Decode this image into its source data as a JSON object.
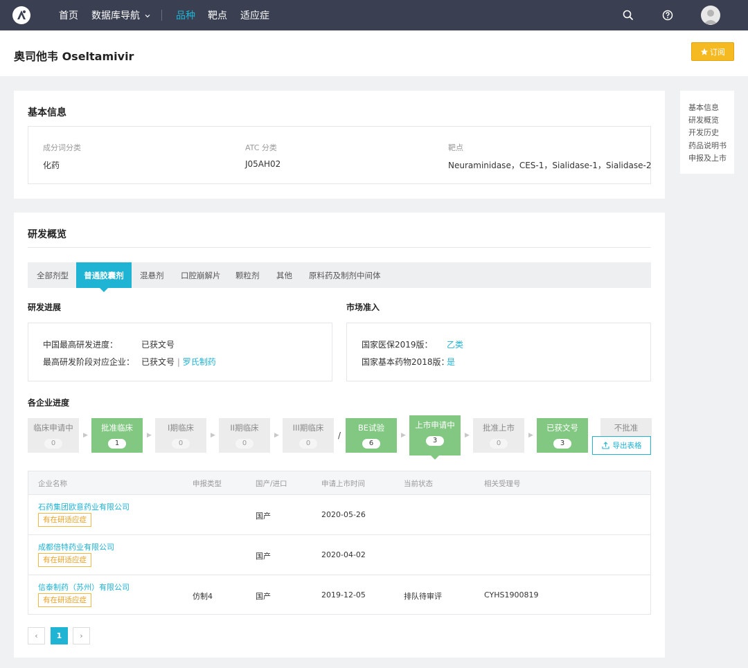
{
  "nav": {
    "items": [
      {
        "label": "首页",
        "active": false
      },
      {
        "label": "数据库导航",
        "active": false
      },
      {
        "label": "品种",
        "active": true
      },
      {
        "label": "靶点",
        "active": false
      },
      {
        "label": "适应症",
        "active": false
      }
    ],
    "dropdown_icon": "chevron-down-icon",
    "icons": [
      "search-icon",
      "help-icon",
      "avatar-icon"
    ]
  },
  "header": {
    "title": "奥司他韦 Oseltamivir",
    "subscribe_label": "订阅"
  },
  "basic_info": {
    "title": "基本信息",
    "fields": [
      {
        "label": "成分词分类",
        "value": "化药"
      },
      {
        "label": "ATC 分类",
        "value": "J05AH02"
      },
      {
        "label": "靶点",
        "value": "Neuraminidase，CES-1，Sialidase-1，Sialidase-2"
      }
    ]
  },
  "toc": {
    "items": [
      "基本信息",
      "研发概览",
      "开发历史",
      "药品说明书",
      "申报及上市"
    ]
  },
  "overview": {
    "title": "研发概览",
    "tabs": [
      {
        "label": "全部剂型",
        "active": false
      },
      {
        "label": "普通胶囊剂",
        "active": true
      },
      {
        "label": "混悬剂",
        "active": false
      },
      {
        "label": "口腔崩解片",
        "active": false
      },
      {
        "label": "颗粒剂",
        "active": false
      },
      {
        "label": "其他",
        "active": false
      },
      {
        "label": "原料药及制剂中间体",
        "active": false
      }
    ],
    "progress": {
      "title": "研发进展",
      "row1_label": "中国最高研发进度：",
      "row1_value": "已获文号",
      "row2_label": "最高研发阶段对应企业：",
      "row2_value": "已获文号",
      "row2_sep": "|",
      "row2_link": "罗氏制药"
    },
    "market": {
      "title": "市场准入",
      "row1_label": "国家医保2019版：",
      "row1_value": "乙类",
      "row2_label": "国家基本药物2018版：",
      "row2_value": "是"
    }
  },
  "pipeline": {
    "title": "各企业进度",
    "stages": [
      {
        "name": "临床申请中",
        "count": "0",
        "highlight": false
      },
      {
        "name": "批准临床",
        "count": "1",
        "highlight": true
      },
      {
        "name": "I期临床",
        "count": "0",
        "highlight": false
      },
      {
        "name": "II期临床",
        "count": "0",
        "highlight": false
      },
      {
        "name": "III期临床",
        "count": "0",
        "highlight": false
      },
      {
        "name": "BE试验",
        "count": "6",
        "highlight": true
      },
      {
        "name": "上市申请中",
        "count": "3",
        "highlight": true,
        "selected": true
      },
      {
        "name": "批准上市",
        "count": "0",
        "highlight": false
      },
      {
        "name": "已获文号",
        "count": "3",
        "highlight": true
      },
      {
        "name": "不批准",
        "count": "",
        "highlight": false
      }
    ],
    "slash": "/",
    "export_label": "导出表格"
  },
  "table": {
    "columns": [
      "企业名称",
      "申报类型",
      "国产/进口",
      "申请上市时间",
      "当前状态",
      "相关受理号"
    ],
    "rows": [
      {
        "company": "石药集团欧意药业有限公司",
        "tag": "有在研适应症",
        "type": "",
        "origin": "国产",
        "date": "2020-05-26",
        "status": "",
        "number": ""
      },
      {
        "company": "成都倍特药业有限公司",
        "tag": "有在研适应症",
        "type": "",
        "origin": "国产",
        "date": "2020-04-02",
        "status": "",
        "number": ""
      },
      {
        "company": "信泰制药（苏州）有限公司",
        "tag": "有在研适应症",
        "type": "仿制4",
        "origin": "国产",
        "date": "2019-12-05",
        "status": "排队待审评",
        "number": "CYHS1900819"
      }
    ]
  },
  "pagination": {
    "prev": "‹",
    "current": "1",
    "next": "›"
  },
  "colors": {
    "nav_bg": "#3a3f51",
    "accent": "#1fb3d4",
    "green": "#82c882",
    "subscribe": "#f5b921",
    "tag": "#e8a020"
  }
}
